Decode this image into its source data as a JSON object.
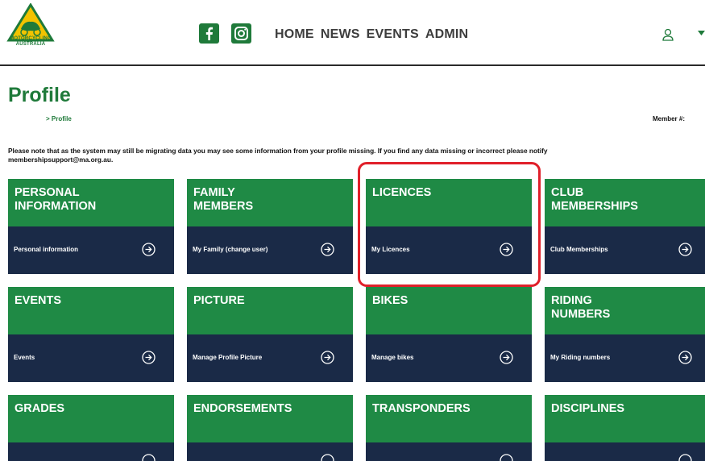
{
  "header": {
    "logo_text": "MOTORCYCLING\nAUSTRALIA",
    "nav": [
      {
        "label": "HOME"
      },
      {
        "label": "NEWS"
      },
      {
        "label": "EVENTS"
      },
      {
        "label": "ADMIN"
      }
    ]
  },
  "page": {
    "title": "Profile",
    "breadcrumb": "> Profile",
    "member_label": "Member #:",
    "notice": "Please note that as the system may still be migrating data you may see some information from your profile missing. If you find any data missing or incorrect please notify membershipsupport@ma.org.au."
  },
  "cards": [
    {
      "title": "PERSONAL\nINFORMATION",
      "link": "Personal information"
    },
    {
      "title": "FAMILY\nMEMBERS",
      "link": "My Family (change user)"
    },
    {
      "title": "LICENCES",
      "link": "My Licences"
    },
    {
      "title": "CLUB\nMEMBERSHIPS",
      "link": "Club Memberships"
    },
    {
      "title": "EVENTS",
      "link": "Events"
    },
    {
      "title": "PICTURE",
      "link": "Manage Profile Picture"
    },
    {
      "title": "BIKES",
      "link": "Manage bikes"
    },
    {
      "title": "RIDING\nNUMBERS",
      "link": "My Riding numbers"
    },
    {
      "title": "GRADES",
      "link": ""
    },
    {
      "title": "ENDORSEMENTS",
      "link": ""
    },
    {
      "title": "TRANSPONDERS",
      "link": ""
    },
    {
      "title": "DISCIPLINES",
      "link": ""
    }
  ],
  "colors": {
    "brand_green": "#1f8a45",
    "title_green": "#1f7a3a",
    "navy": "#1a2a47",
    "highlight_red": "#e0202a"
  }
}
